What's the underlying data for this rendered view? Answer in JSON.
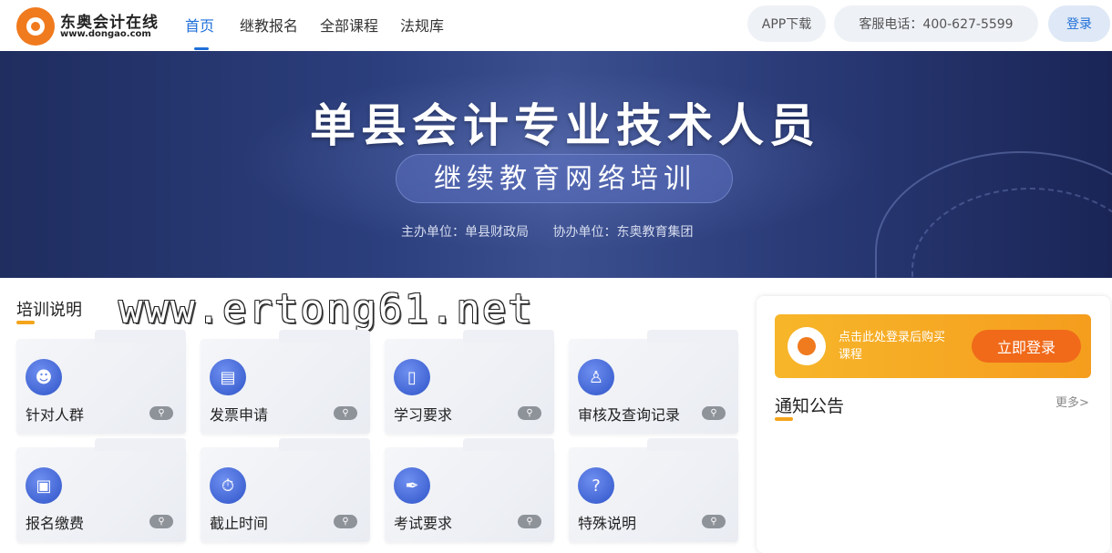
{
  "brand": {
    "name": "东奥会计在线",
    "url": "www.dongao.com"
  },
  "nav": {
    "items": [
      "首页",
      "继教报名",
      "全部课程",
      "法规库"
    ],
    "active": "首页"
  },
  "header_actions": {
    "app_download": "APP下载",
    "hotline": "客服电话：400-627-5599",
    "login": "登录"
  },
  "banner": {
    "title": "单县会计专业技术人员",
    "subtitle": "继续教育网络培训",
    "host": "主办单位：单县财政局",
    "co_host": "协办单位：东奥教育集团"
  },
  "training": {
    "title": "培训说明",
    "cards": [
      {
        "label": "针对人群",
        "icon": "users-icon"
      },
      {
        "label": "发票申请",
        "icon": "invoice-icon"
      },
      {
        "label": "学习要求",
        "icon": "book-icon"
      },
      {
        "label": "审核及查询记录",
        "icon": "person-icon"
      },
      {
        "label": "报名缴费",
        "icon": "wallet-icon"
      },
      {
        "label": "截止时间",
        "icon": "stopwatch-icon"
      },
      {
        "label": "考试要求",
        "icon": "pen-icon"
      },
      {
        "label": "特殊说明",
        "icon": "clipboard-icon"
      }
    ]
  },
  "watermark": "www.ertong61.net",
  "sidebar": {
    "promo_text": "点击此处登录后购买课程",
    "promo_button": "立即登录",
    "notice_title": "通知公告",
    "more": "更多>"
  }
}
